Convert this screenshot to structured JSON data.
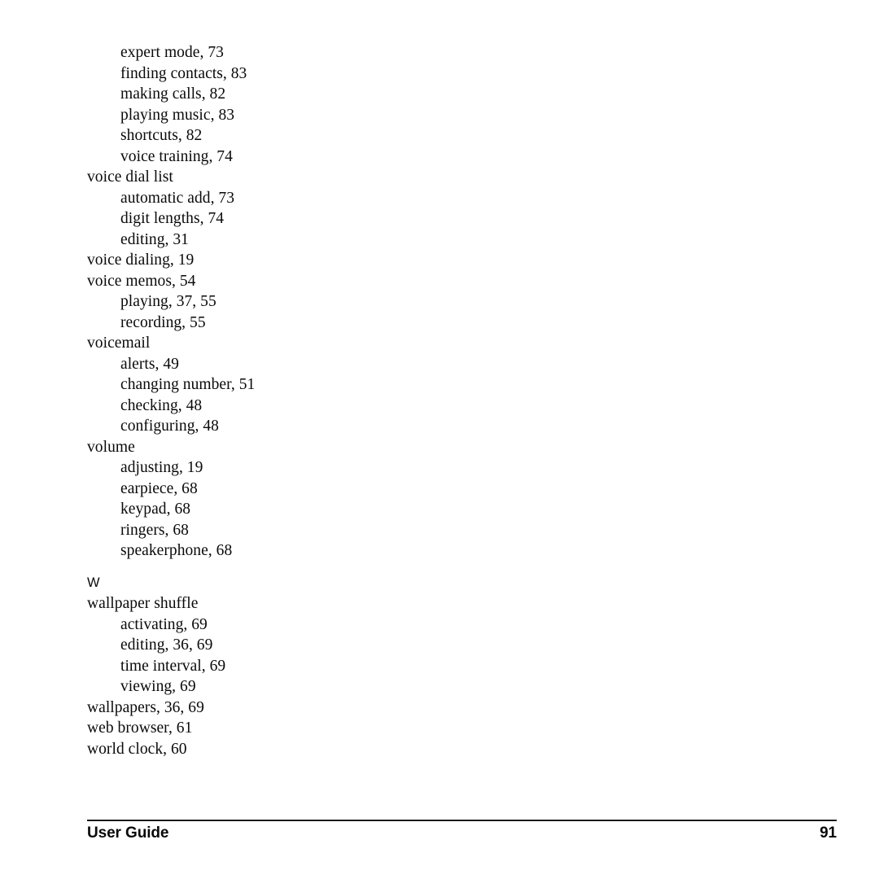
{
  "document": {
    "type": "index",
    "page_number": "91",
    "footer": {
      "label": "User Guide",
      "page_number": "91"
    }
  },
  "index": {
    "entries": [
      {
        "text": "expert mode, 73",
        "level": 2
      },
      {
        "text": "finding contacts, 83",
        "level": 2
      },
      {
        "text": "making calls, 82",
        "level": 2
      },
      {
        "text": "playing music, 83",
        "level": 2
      },
      {
        "text": "shortcuts, 82",
        "level": 2
      },
      {
        "text": "voice training, 74",
        "level": 2
      },
      {
        "text": "voice dial list",
        "level": 1
      },
      {
        "text": "automatic add, 73",
        "level": 2
      },
      {
        "text": "digit lengths, 74",
        "level": 2
      },
      {
        "text": "editing, 31",
        "level": 2
      },
      {
        "text": "voice dialing, 19",
        "level": 1
      },
      {
        "text": "voice memos, 54",
        "level": 1
      },
      {
        "text": "playing, 37, 55",
        "level": 2
      },
      {
        "text": "recording, 55",
        "level": 2
      },
      {
        "text": "voicemail",
        "level": 1
      },
      {
        "text": "alerts, 49",
        "level": 2
      },
      {
        "text": "changing number, 51",
        "level": 2
      },
      {
        "text": "checking, 48",
        "level": 2
      },
      {
        "text": "configuring, 48",
        "level": 2
      },
      {
        "text": "volume",
        "level": 1
      },
      {
        "text": "adjusting, 19",
        "level": 2
      },
      {
        "text": "earpiece, 68",
        "level": 2
      },
      {
        "text": "keypad, 68",
        "level": 2
      },
      {
        "text": "ringers, 68",
        "level": 2
      },
      {
        "text": "speakerphone, 68",
        "level": 2
      },
      {
        "text": "W",
        "level": 0
      },
      {
        "text": "wallpaper shuffle",
        "level": 1
      },
      {
        "text": "activating, 69",
        "level": 2
      },
      {
        "text": "editing, 36, 69",
        "level": 2
      },
      {
        "text": "time interval, 69",
        "level": 2
      },
      {
        "text": "viewing, 69",
        "level": 2
      },
      {
        "text": "wallpapers, 36, 69",
        "level": 1
      },
      {
        "text": "web browser, 61",
        "level": 1
      },
      {
        "text": "world clock, 60",
        "level": 1
      }
    ]
  }
}
